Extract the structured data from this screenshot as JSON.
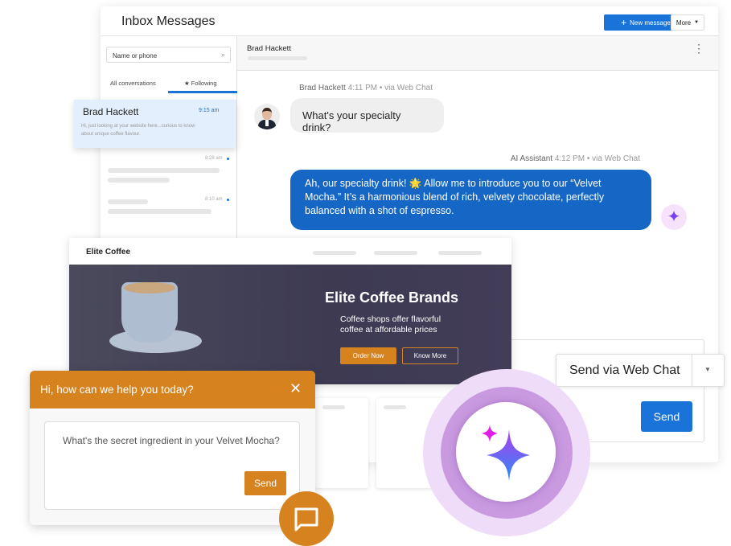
{
  "inbox": {
    "title": "Inbox Messages",
    "new_message": "New message",
    "more": "More",
    "search_placeholder": "Name or phone",
    "tabs": [
      {
        "label": "All conversations"
      },
      {
        "label": "★ Following"
      }
    ],
    "conversations": [
      {
        "name": "Brad Hackett",
        "time": "9:15 am",
        "preview": "Hi, just looking at your website here...curious to know about unique coffee flavour."
      },
      {
        "time": "8:28 am"
      },
      {
        "time": "8:10 am"
      }
    ],
    "chat": {
      "contact": "Brad Hackett",
      "messages": [
        {
          "sender": "Brad Hackett",
          "meta": "4:11 PM • via Web Chat",
          "text": "What's your specialty drink?"
        },
        {
          "sender": "AI Assistant",
          "meta": "4:12 PM • via Web Chat",
          "text": "Ah, our specialty drink! 🌟 Allow me to introduce you to our “Velvet Mocha.” It’s a harmonious blend of rich, velvety chocolate, perfectly balanced with a shot of espresso."
        }
      ],
      "channel": "Send via Web Chat",
      "send": "Send"
    }
  },
  "website": {
    "brand": "Elite Coffee",
    "hero_title": "Elite Coffee Brands",
    "hero_sub": "Coffee shops offer flavorful coffee at affordable prices",
    "order": "Order Now",
    "know": "Know More"
  },
  "widget": {
    "greeting": "Hi, how can we help you today?",
    "message": "What's the secret ingredient in your Velvet Mocha?",
    "send": "Send"
  },
  "colors": {
    "primary": "#1a73d9",
    "bubble": "#1666c5",
    "orange": "#d6821f",
    "ai_ring": "#c99ae0"
  }
}
